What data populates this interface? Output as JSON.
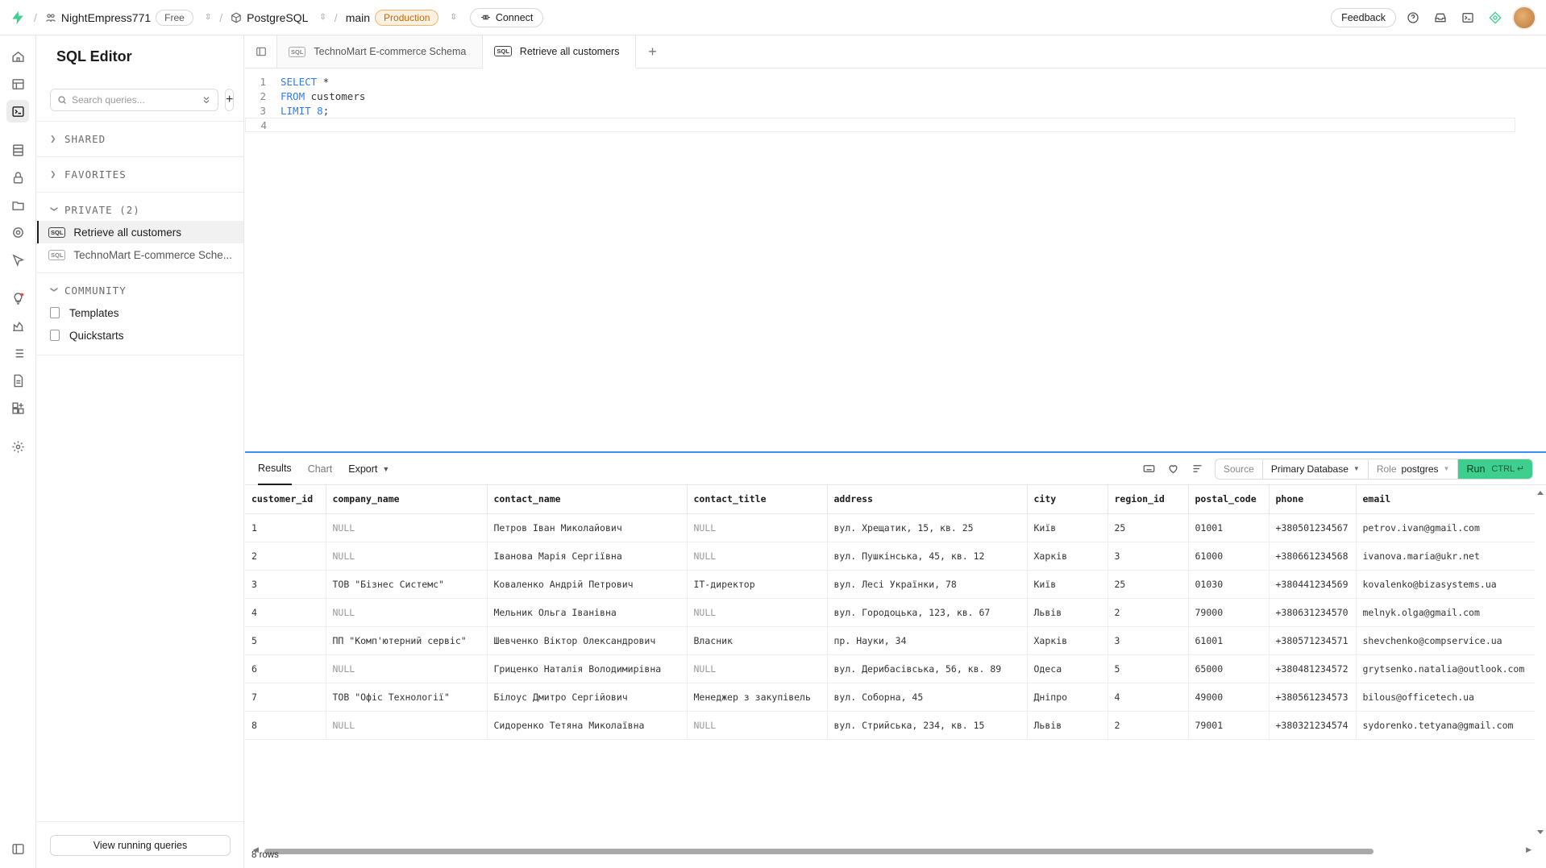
{
  "topbar": {
    "org": "NightEmpress771",
    "plan": "Free",
    "project": "PostgreSQL",
    "branch": "main",
    "env": "Production",
    "connect": "Connect",
    "feedback": "Feedback"
  },
  "sidebar": {
    "title": "SQL Editor",
    "search_placeholder": "Search queries...",
    "sections": {
      "shared": "SHARED",
      "favorites": "FAVORITES",
      "private": "PRIVATE (2)",
      "community": "COMMUNITY"
    },
    "private_items": [
      "Retrieve all customers",
      "TechnoMart E-commerce Sche..."
    ],
    "community_items": [
      "Templates",
      "Quickstarts"
    ],
    "footer_button": "View running queries",
    "sql_badge": "SQL"
  },
  "tabs": [
    "TechnoMart E-commerce Schema",
    "Retrieve all customers"
  ],
  "editor": {
    "line_numbers": [
      "1",
      "2",
      "3",
      "4"
    ],
    "kw_select": "SELECT",
    "star": " *",
    "kw_from": "FROM",
    "table": " customers",
    "kw_limit": "LIMIT",
    "limit_value": " 8",
    "semicolon": ";"
  },
  "results": {
    "tabs": [
      "Results",
      "Chart",
      "Export"
    ],
    "source_label": "Source",
    "source_value": "Primary Database",
    "role_label": "Role",
    "role_value": "postgres",
    "run_label": "Run",
    "run_shortcut": "CTRL ↵",
    "row_count": "8 rows",
    "columns": [
      "customer_id",
      "company_name",
      "contact_name",
      "contact_title",
      "address",
      "city",
      "region_id",
      "postal_code",
      "phone",
      "email"
    ],
    "rows": [
      [
        "1",
        "NULL",
        "Петров Іван Миколайович",
        "NULL",
        "вул. Хрещатик, 15, кв. 25",
        "Київ",
        "25",
        "01001",
        "+380501234567",
        "petrov.ivan@gmail.com"
      ],
      [
        "2",
        "NULL",
        "Іванова Марія Сергіївна",
        "NULL",
        "вул. Пушкінська, 45, кв. 12",
        "Харків",
        "3",
        "61000",
        "+380661234568",
        "ivanova.maria@ukr.net"
      ],
      [
        "3",
        "ТОВ \"Бізнес Системс\"",
        "Коваленко Андрій Петрович",
        "IT-директор",
        "вул. Лесі Українки, 78",
        "Київ",
        "25",
        "01030",
        "+380441234569",
        "kovalenko@bizasystems.ua"
      ],
      [
        "4",
        "NULL",
        "Мельник Ольга Іванівна",
        "NULL",
        "вул. Городоцька, 123, кв. 67",
        "Львів",
        "2",
        "79000",
        "+380631234570",
        "melnyk.olga@gmail.com"
      ],
      [
        "5",
        "ПП \"Комп'ютерний сервіс\"",
        "Шевченко Віктор Олександрович",
        "Власник",
        "пр. Науки, 34",
        "Харків",
        "3",
        "61001",
        "+380571234571",
        "shevchenko@compservice.ua"
      ],
      [
        "6",
        "NULL",
        "Гриценко Наталія Володимирівна",
        "NULL",
        "вул. Дерибасівська, 56, кв. 89",
        "Одеса",
        "5",
        "65000",
        "+380481234572",
        "grytsenko.natalia@outlook.com"
      ],
      [
        "7",
        "ТОВ \"Офіс Технології\"",
        "Білоус Дмитро Сергійович",
        "Менеджер з закупівель",
        "вул. Соборна, 45",
        "Дніпро",
        "4",
        "49000",
        "+380561234573",
        "bilous@officetech.ua"
      ],
      [
        "8",
        "NULL",
        "Сидоренко Тетяна Миколаївна",
        "NULL",
        "вул. Стрийська, 234, кв. 15",
        "Львів",
        "2",
        "79001",
        "+380321234574",
        "sydorenko.tetyana@gmail.com"
      ]
    ]
  },
  "colors": {
    "accent_green": "#3ecf8e",
    "production_orange": "#c26a06",
    "keyword_blue": "#2f7bf6",
    "results_border_blue": "#3e91f0"
  }
}
